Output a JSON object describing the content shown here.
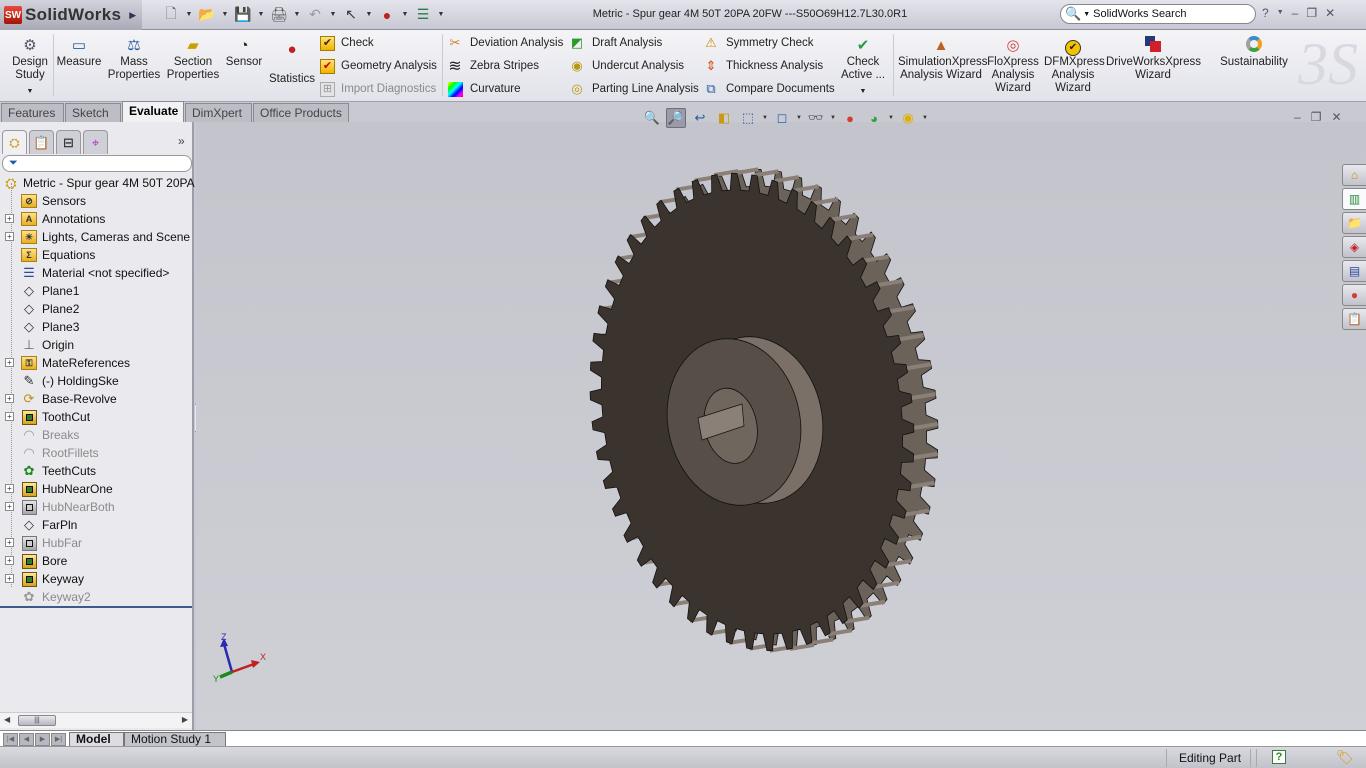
{
  "app": {
    "name": "SolidWorks",
    "logo_badge": "SW",
    "document_title": "Metric - Spur gear 4M 50T 20PA 20FW ---S50O69H12.7L30.0R1",
    "search_placeholder": "SolidWorks Search",
    "help_glyph": "?",
    "window_controls": {
      "minimize": "–",
      "restore": "❐",
      "close": "✕"
    }
  },
  "quick_access": [
    {
      "name": "new",
      "glyph": "🗋"
    },
    {
      "name": "open",
      "glyph": "📂"
    },
    {
      "name": "save",
      "glyph": "💾"
    },
    {
      "name": "print",
      "glyph": "🖨"
    },
    {
      "name": "undo",
      "glyph": "↶"
    },
    {
      "name": "select",
      "glyph": "↖"
    },
    {
      "name": "rebuild",
      "glyph": "●"
    },
    {
      "name": "options",
      "glyph": "☰"
    }
  ],
  "ribbon": {
    "large_buttons": [
      {
        "id": "design-study",
        "label1": "Design",
        "label2": "Study",
        "glyph": "⚙"
      },
      {
        "id": "measure",
        "label1": "Measure",
        "label2": "",
        "glyph": "📏"
      },
      {
        "id": "mass-properties",
        "label1": "Mass",
        "label2": "Properties",
        "glyph": "⚖"
      },
      {
        "id": "section-properties",
        "label1": "Section",
        "label2": "Properties",
        "glyph": "▱"
      },
      {
        "id": "sensor",
        "label1": "Sensor",
        "label2": "",
        "glyph": "◔"
      },
      {
        "id": "statistics",
        "label1": "Statistics",
        "label2": "",
        "glyph": "🚦"
      },
      {
        "id": "check-active",
        "label1": "Check",
        "label2": "Active ...",
        "glyph": "✔"
      },
      {
        "id": "simulationxpress",
        "label1": "SimulationXpress",
        "label2": "Analysis Wizard",
        "glyph": "▲"
      },
      {
        "id": "floxpress",
        "label1": "FloXpress",
        "label2": "Analysis",
        "label3": "Wizard",
        "glyph": "◎"
      },
      {
        "id": "dfmxpress",
        "label1": "DFMXpress",
        "label2": "Analysis",
        "label3": "Wizard",
        "glyph": "✔"
      },
      {
        "id": "driveworksxpress",
        "label1": "DriveWorksXpress",
        "label2": "Wizard",
        "glyph": "■"
      },
      {
        "id": "sustainability",
        "label1": "Sustainability",
        "label2": "",
        "glyph": "◌"
      }
    ],
    "small_buttons": [
      {
        "id": "check",
        "label": "Check",
        "glyph": "✔",
        "enabled": true
      },
      {
        "id": "geometry-analysis",
        "label": "Geometry Analysis",
        "glyph": "✔",
        "enabled": true
      },
      {
        "id": "import-diagnostics",
        "label": "Import Diagnostics",
        "glyph": "⊞",
        "enabled": false
      },
      {
        "id": "deviation-analysis",
        "label": "Deviation Analysis",
        "glyph": "✂",
        "enabled": true
      },
      {
        "id": "zebra-stripes",
        "label": "Zebra Stripes",
        "glyph": "≋",
        "enabled": true
      },
      {
        "id": "curvature",
        "label": "Curvature",
        "glyph": "■",
        "enabled": true
      },
      {
        "id": "draft-analysis",
        "label": "Draft Analysis",
        "glyph": "◩",
        "enabled": true
      },
      {
        "id": "undercut-analysis",
        "label": "Undercut Analysis",
        "glyph": "◉",
        "enabled": true
      },
      {
        "id": "parting-line-analysis",
        "label": "Parting Line Analysis",
        "glyph": "◎",
        "enabled": true
      },
      {
        "id": "symmetry-check",
        "label": "Symmetry Check",
        "glyph": "⚠",
        "enabled": true
      },
      {
        "id": "thickness-analysis",
        "label": "Thickness Analysis",
        "glyph": "⇕",
        "enabled": true
      },
      {
        "id": "compare-documents",
        "label": "Compare Documents",
        "glyph": "⧉",
        "enabled": true
      }
    ]
  },
  "command_tabs": [
    {
      "label": "Features",
      "active": false
    },
    {
      "label": "Sketch",
      "active": false
    },
    {
      "label": "Evaluate",
      "active": true
    },
    {
      "label": "DimXpert",
      "active": false
    },
    {
      "label": "Office Products",
      "active": false
    }
  ],
  "manager_tabs": [
    {
      "name": "featuremanager",
      "glyph": "⛭"
    },
    {
      "name": "propertymanager",
      "glyph": "📋"
    },
    {
      "name": "configurationmanager",
      "glyph": "⊟"
    },
    {
      "name": "dimxpertmanager",
      "glyph": "⌖"
    }
  ],
  "manager_more": "»",
  "filter_glyph": "⏷",
  "feature_tree": {
    "root": "Metric - Spur gear 4M 50T 20PA",
    "items": [
      {
        "label": "Sensors",
        "icon": "folder",
        "glyph": "⊘",
        "expandable": false,
        "suppressed": false
      },
      {
        "label": "Annotations",
        "icon": "folder",
        "glyph": "A",
        "expandable": true,
        "suppressed": false
      },
      {
        "label": "Lights, Cameras and Scene",
        "icon": "folder",
        "glyph": "☀",
        "expandable": true,
        "suppressed": false
      },
      {
        "label": "Equations",
        "icon": "folder",
        "glyph": "Σ",
        "expandable": false,
        "suppressed": false
      },
      {
        "label": "Material <not specified>",
        "icon": "material",
        "glyph": "☰",
        "expandable": false,
        "suppressed": false
      },
      {
        "label": "Plane1",
        "icon": "plane",
        "glyph": "◇",
        "expandable": false,
        "suppressed": false
      },
      {
        "label": "Plane2",
        "icon": "plane",
        "glyph": "◇",
        "expandable": false,
        "suppressed": false
      },
      {
        "label": "Plane3",
        "icon": "plane",
        "glyph": "◇",
        "expandable": false,
        "suppressed": false
      },
      {
        "label": "Origin",
        "icon": "origin",
        "glyph": "⊥",
        "expandable": false,
        "suppressed": false
      },
      {
        "label": "MateReferences",
        "icon": "folder",
        "glyph": "⚿",
        "expandable": true,
        "suppressed": false
      },
      {
        "label": "(-) HoldingSke",
        "icon": "sketch",
        "glyph": "✎",
        "expandable": false,
        "suppressed": false
      },
      {
        "label": "Base-Revolve",
        "icon": "revolve",
        "glyph": "⟳",
        "expandable": true,
        "suppressed": false
      },
      {
        "label": "ToothCut",
        "icon": "feature",
        "glyph": "",
        "expandable": true,
        "suppressed": false
      },
      {
        "label": "Breaks",
        "icon": "fillet",
        "glyph": "◠",
        "expandable": false,
        "suppressed": true
      },
      {
        "label": "RootFillets",
        "icon": "fillet",
        "glyph": "◠",
        "expandable": false,
        "suppressed": true
      },
      {
        "label": "TeethCuts",
        "icon": "pattern",
        "glyph": "✿",
        "expandable": false,
        "suppressed": false
      },
      {
        "label": "HubNearOne",
        "icon": "feature",
        "glyph": "",
        "expandable": true,
        "suppressed": false
      },
      {
        "label": "HubNearBoth",
        "icon": "feature-gray",
        "glyph": "",
        "expandable": true,
        "suppressed": true
      },
      {
        "label": "FarPln",
        "icon": "plane",
        "glyph": "◇",
        "expandable": false,
        "suppressed": false
      },
      {
        "label": "HubFar",
        "icon": "feature-gray",
        "glyph": "",
        "expandable": true,
        "suppressed": true
      },
      {
        "label": "Bore",
        "icon": "feature",
        "glyph": "",
        "expandable": true,
        "suppressed": false
      },
      {
        "label": "Keyway",
        "icon": "feature",
        "glyph": "",
        "expandable": true,
        "suppressed": false
      },
      {
        "label": "Keyway2",
        "icon": "pattern-gray",
        "glyph": "✿",
        "expandable": false,
        "suppressed": true
      }
    ]
  },
  "heads_up_toolbar": [
    {
      "name": "zoom-to-fit",
      "glyph": "🔍",
      "dropdown": false,
      "active": false
    },
    {
      "name": "zoom-to-area",
      "glyph": "🔎",
      "dropdown": false,
      "active": true
    },
    {
      "name": "previous-view",
      "glyph": "↩",
      "dropdown": false,
      "active": false
    },
    {
      "name": "section-view",
      "glyph": "◧",
      "dropdown": false,
      "active": false
    },
    {
      "name": "view-orientation",
      "glyph": "⬚",
      "dropdown": true,
      "active": false
    },
    {
      "name": "display-style",
      "glyph": "◻",
      "dropdown": true,
      "active": false
    },
    {
      "name": "hide-show-items",
      "glyph": "👓",
      "dropdown": true,
      "active": false
    },
    {
      "name": "edit-appearance",
      "glyph": "●",
      "dropdown": false,
      "active": false
    },
    {
      "name": "apply-scene",
      "glyph": "◕",
      "dropdown": true,
      "active": false
    },
    {
      "name": "view-settings",
      "glyph": "◉",
      "dropdown": true,
      "active": false
    }
  ],
  "task_pane": [
    {
      "name": "solidworks-resources",
      "glyph": "⌂"
    },
    {
      "name": "design-library",
      "glyph": "▥"
    },
    {
      "name": "file-explorer",
      "glyph": "📁"
    },
    {
      "name": "search",
      "glyph": "◈"
    },
    {
      "name": "view-palette",
      "glyph": "▤"
    },
    {
      "name": "appearances",
      "glyph": "●"
    },
    {
      "name": "custom-properties",
      "glyph": "📋"
    }
  ],
  "triad": {
    "x": "X",
    "y": "Y",
    "z": "Z"
  },
  "bottom_tabs": [
    {
      "label": "Model",
      "active": true
    },
    {
      "label": "Motion Study 1",
      "active": false
    }
  ],
  "status": {
    "mode": "Editing Part",
    "help_glyph": "?",
    "tag_glyph": "🏷"
  },
  "model": {
    "tooth_count": 50,
    "colors": {
      "body": "#3b342e",
      "flank": "#6b625a",
      "hub": "#564e47",
      "hub_side": "#7a7068",
      "edge": "#111111"
    }
  }
}
